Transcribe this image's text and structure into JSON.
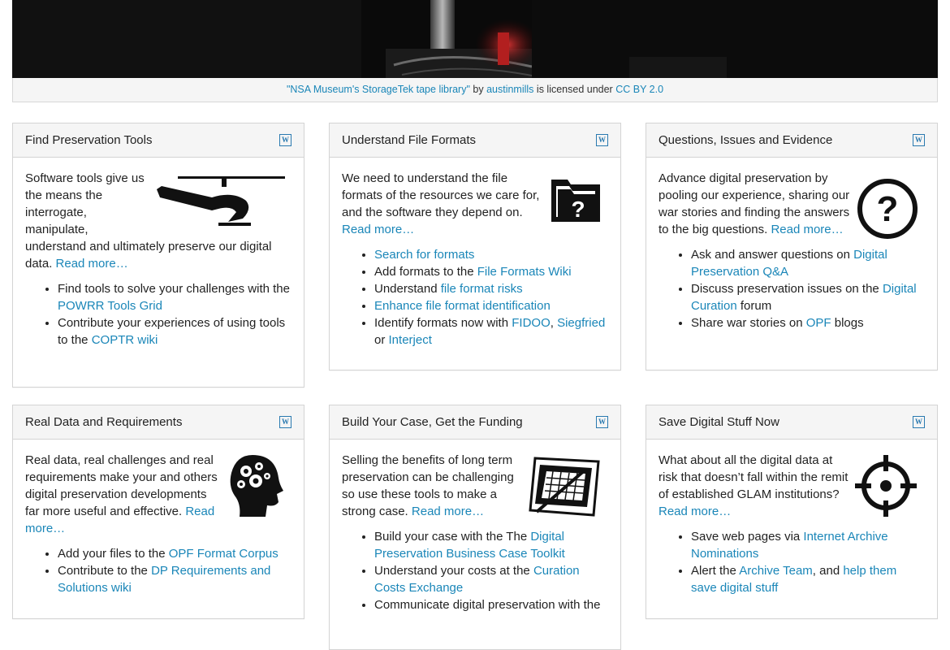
{
  "credit": {
    "title": "\"NSA Museum's StorageTek tape library\"",
    "by": " by ",
    "author": "austinmills",
    "licensed": " is licensed under ",
    "license": "CC BY 2.0"
  },
  "cards": [
    {
      "title": "Find Preservation Tools",
      "icon": "helicopter-icon",
      "text": "Software tools give us the means the interrogate, manipulate, understand and ultimately preserve our digital data. ",
      "readmore": "Read more…",
      "items": [
        {
          "pre": "Find tools to solve your challenges with the ",
          "l1": "POWRR Tools Grid",
          "mid": "",
          "l2": "",
          "mid2": "",
          "l3": "",
          "post": ""
        },
        {
          "pre": "Contribute your experiences of using tools to the ",
          "l1": "COPTR wiki",
          "mid": "",
          "l2": "",
          "mid2": "",
          "l3": "",
          "post": ""
        }
      ]
    },
    {
      "title": "Understand File Formats",
      "icon": "file-question-icon",
      "text": "We need to understand the file formats of the resources we care for, and the software they depend on. ",
      "readmore": "Read more…",
      "items": [
        {
          "pre": "",
          "l1": "Search for formats",
          "mid": "",
          "l2": "",
          "mid2": "",
          "l3": "",
          "post": ""
        },
        {
          "pre": "Add formats to the ",
          "l1": "File Formats Wiki",
          "mid": "",
          "l2": "",
          "mid2": "",
          "l3": "",
          "post": ""
        },
        {
          "pre": "Understand ",
          "l1": "file format risks",
          "mid": "",
          "l2": "",
          "mid2": "",
          "l3": "",
          "post": ""
        },
        {
          "pre": "",
          "l1": "Enhance file format identification",
          "mid": "",
          "l2": "",
          "mid2": "",
          "l3": "",
          "post": ""
        },
        {
          "pre": "Identify formats now with ",
          "l1": "FIDOO",
          "mid": ", ",
          "l2": "Siegfried",
          "mid2": " or ",
          "l3": "Interject",
          "post": ""
        }
      ]
    },
    {
      "title": "Questions, Issues and Evidence",
      "icon": "question-circle-icon",
      "text": "Advance digital preservation by pooling our experience, sharing our war stories and finding the answers to the big questions. ",
      "readmore": "Read more…",
      "items": [
        {
          "pre": "Ask and answer questions on ",
          "l1": "Digital Preservation Q&A",
          "mid": "",
          "l2": "",
          "mid2": "",
          "l3": "",
          "post": ""
        },
        {
          "pre": "Discuss preservation issues on the ",
          "l1": "Digital Curation",
          "mid": "",
          "l2": "",
          "mid2": "",
          "l3": "",
          "post": " forum"
        },
        {
          "pre": "Share war stories on ",
          "l1": "OPF",
          "mid": "",
          "l2": "",
          "mid2": "",
          "l3": "",
          "post": " blogs"
        }
      ]
    },
    {
      "title": "Real Data and Requirements",
      "icon": "head-gears-icon",
      "text": "Real data, real challenges and real requirements make your and others digital preservation developments far more useful and effective. ",
      "readmore": "Read more…",
      "items": [
        {
          "pre": "Add your files to the ",
          "l1": "OPF Format Corpus",
          "mid": "",
          "l2": "",
          "mid2": "",
          "l3": "",
          "post": ""
        },
        {
          "pre": "Contribute to the ",
          "l1": "DP Requirements and Solutions wiki",
          "mid": "",
          "l2": "",
          "mid2": "",
          "l3": "",
          "post": ""
        }
      ]
    },
    {
      "title": "Build Your Case, Get the Funding",
      "icon": "calculator-blueprint-icon",
      "text": "Selling the benefits of long term preservation can be challenging so use these tools to make a strong case. ",
      "readmore": "Read more…",
      "items": [
        {
          "pre": "Build your case with the The ",
          "l1": "Digital Preservation Business Case Toolkit",
          "mid": "",
          "l2": "",
          "mid2": "",
          "l3": "",
          "post": ""
        },
        {
          "pre": "Understand your costs at the ",
          "l1": "Curation Costs Exchange",
          "mid": "",
          "l2": "",
          "mid2": "",
          "l3": "",
          "post": ""
        },
        {
          "pre": "Communicate digital preservation with the ",
          "l1": "",
          "mid": "",
          "l2": "",
          "mid2": "",
          "l3": "",
          "post": ""
        }
      ]
    },
    {
      "title": "Save Digital Stuff Now",
      "icon": "crosshair-icon",
      "text": "What about all the digital data at risk that doesn’t fall within the remit of established GLAM institutions? ",
      "readmore": "Read more…",
      "items": [
        {
          "pre": "Save web pages via ",
          "l1": "Internet Archive Nominations",
          "mid": "",
          "l2": "",
          "mid2": "",
          "l3": "",
          "post": ""
        },
        {
          "pre": "Alert the ",
          "l1": "Archive Team",
          "mid": ", and ",
          "l2": "help them save digital stuff",
          "mid2": "",
          "l3": "",
          "post": ""
        }
      ]
    }
  ],
  "wiki_icon": "W"
}
